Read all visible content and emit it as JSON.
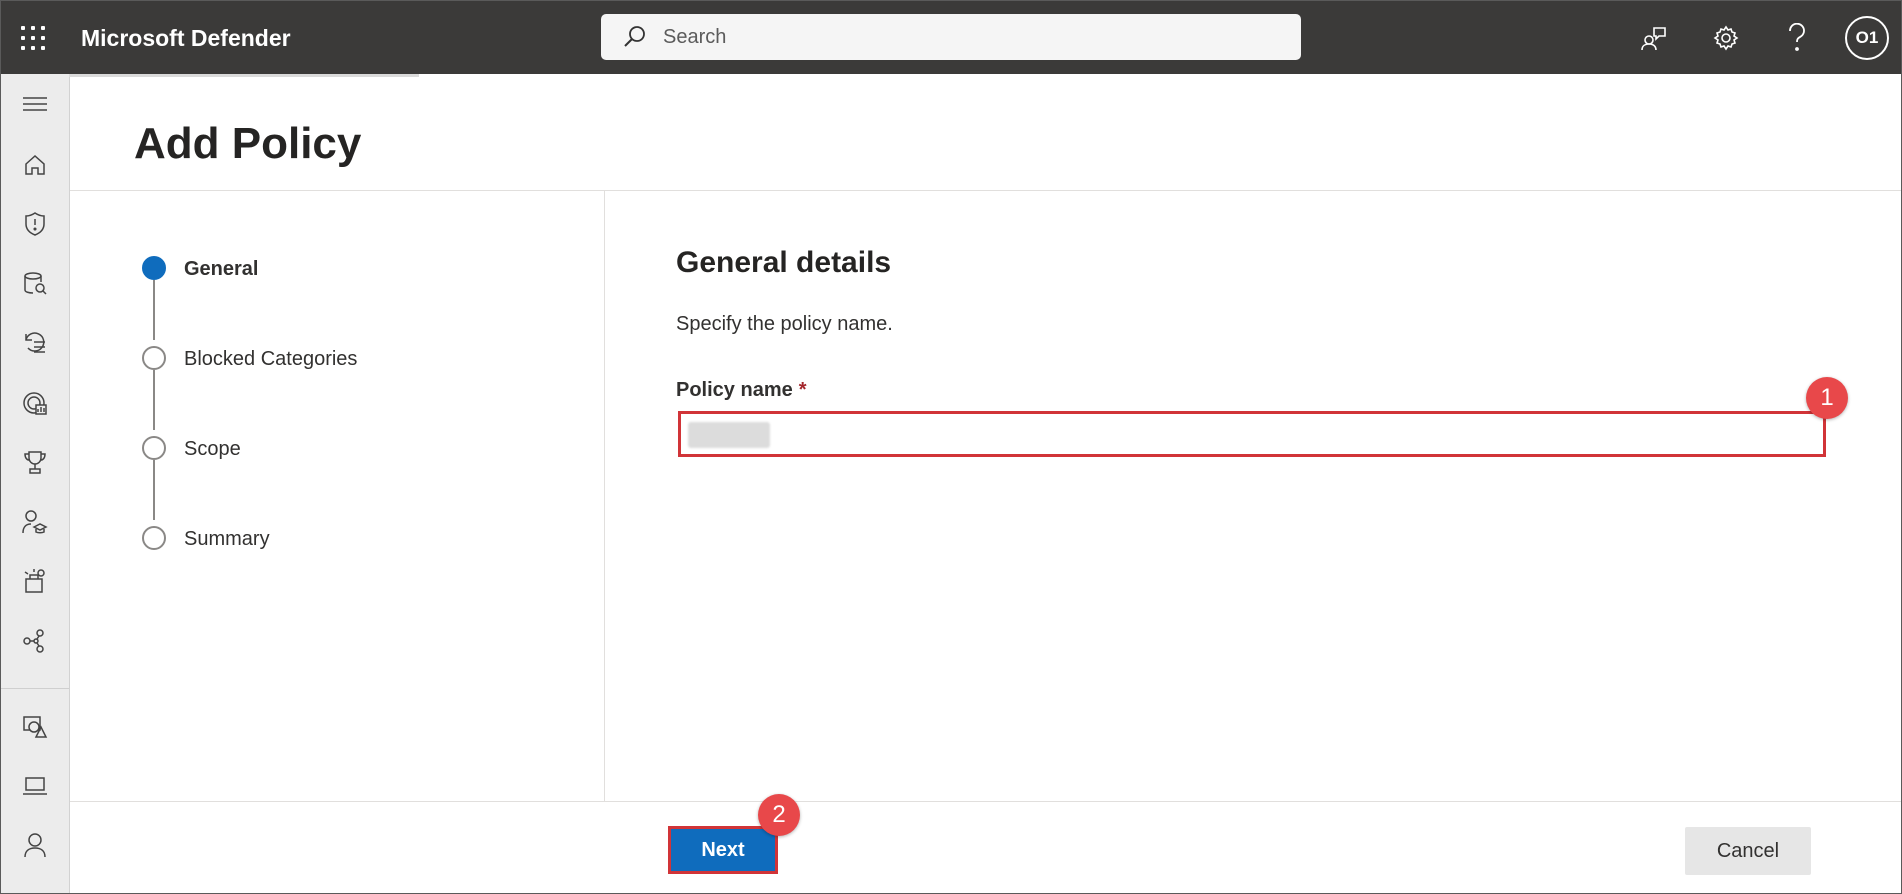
{
  "app": {
    "title": "Microsoft Defender"
  },
  "search": {
    "placeholder": "Search"
  },
  "topbar": {
    "icons": [
      "community-icon",
      "settings-icon",
      "help-icon"
    ],
    "avatar_initials": "O1"
  },
  "leftnav": {
    "icons": [
      "hamburger-icon",
      "home-icon",
      "shield-icon",
      "incidents-icon",
      "hunting-icon",
      "threat-analytics-icon",
      "secure-score-icon",
      "learning-hub-icon",
      "trials-icon",
      "partners-icon",
      "assets-icon",
      "devices-icon",
      "identities-icon"
    ]
  },
  "page": {
    "title": "Add Policy"
  },
  "wizard": {
    "steps": [
      {
        "label": "General",
        "active": true
      },
      {
        "label": "Blocked Categories",
        "active": false
      },
      {
        "label": "Scope",
        "active": false
      },
      {
        "label": "Summary",
        "active": false
      }
    ]
  },
  "form": {
    "title": "General details",
    "description": "Specify the policy name.",
    "policy_name_label": "Policy name",
    "required_mark": "*"
  },
  "callouts": {
    "one": "1",
    "two": "2"
  },
  "footer": {
    "next_label": "Next",
    "cancel_label": "Cancel"
  },
  "colors": {
    "accent": "#0f6cbd",
    "highlight": "#d13438",
    "topbar": "#3b3a39"
  }
}
